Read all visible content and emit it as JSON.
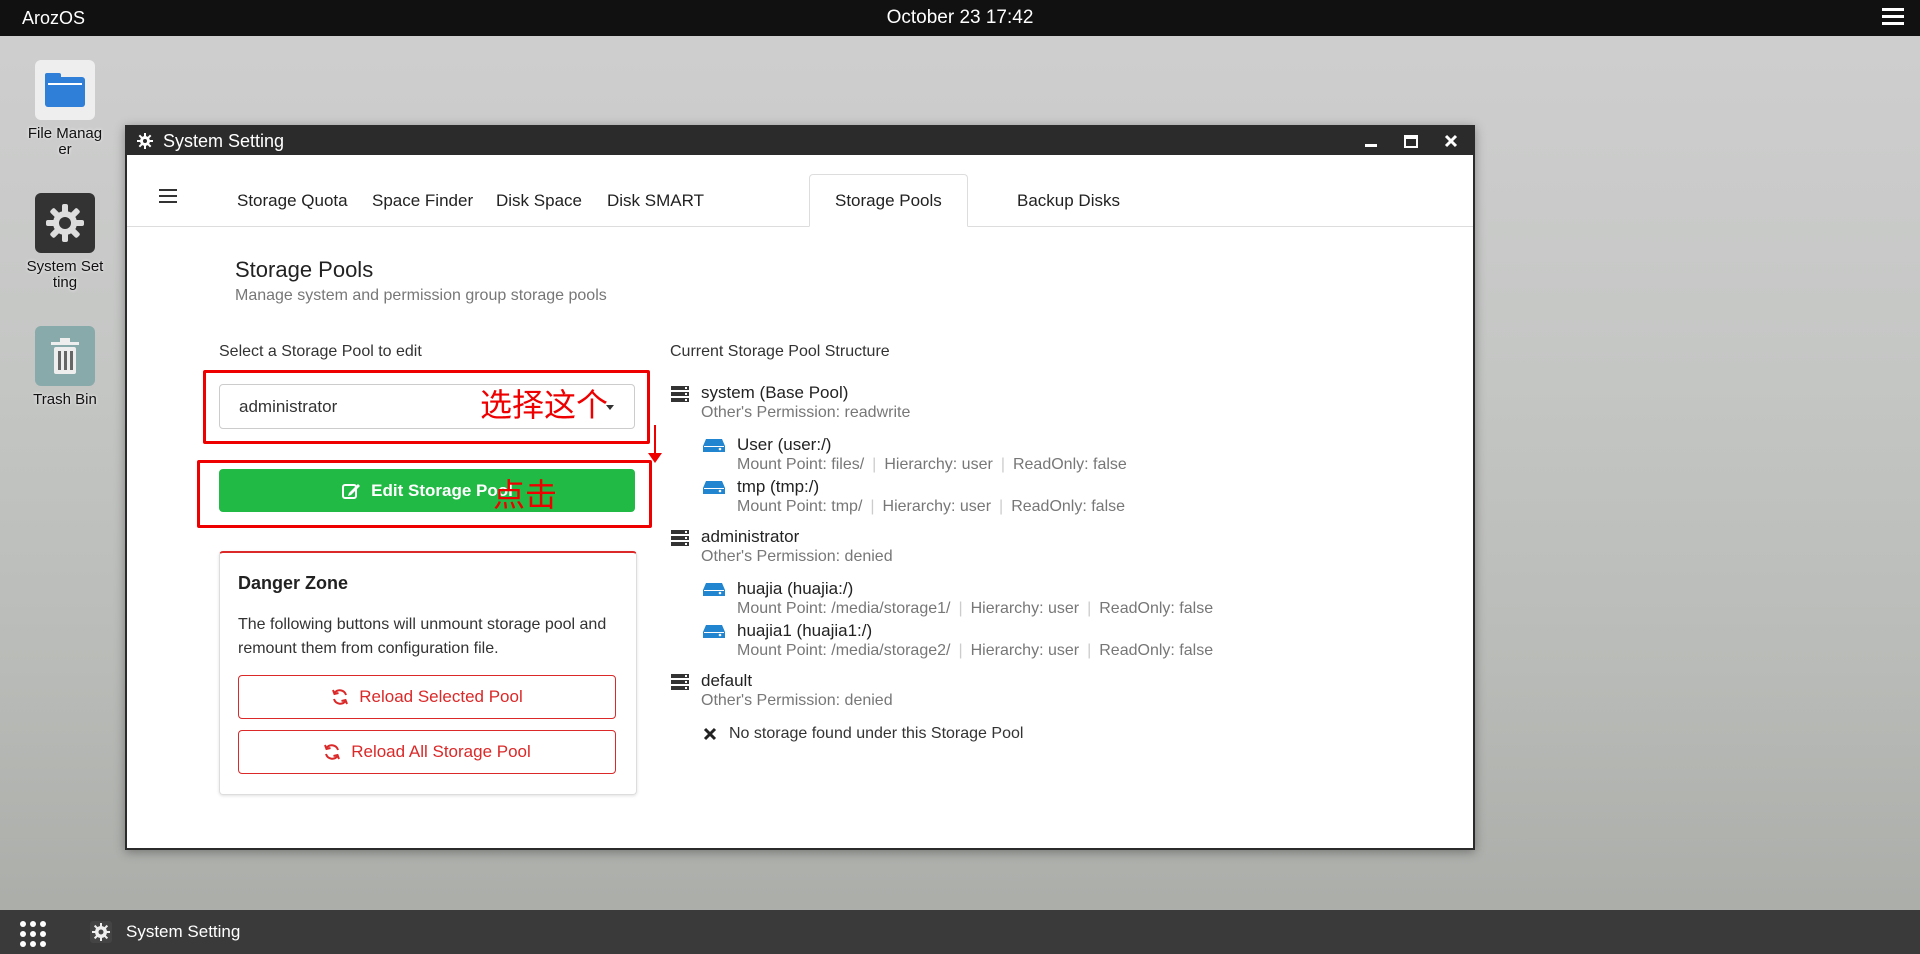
{
  "topbar": {
    "os_name": "ArozOS",
    "clock": "October 23 17:42"
  },
  "desktop": {
    "icons": [
      {
        "label": "File Manager"
      },
      {
        "label": "System Setting"
      },
      {
        "label": "Trash Bin"
      }
    ]
  },
  "window": {
    "title": "System Setting",
    "tabs": [
      {
        "label": "Storage Quota"
      },
      {
        "label": "Space Finder"
      },
      {
        "label": "Disk Space"
      },
      {
        "label": "Disk SMART"
      },
      {
        "label": "Storage Pools"
      },
      {
        "label": "Backup Disks"
      }
    ],
    "active_tab": "Storage Pools",
    "section": {
      "title": "Storage Pools",
      "subtitle": "Manage system and permission group storage pools"
    },
    "select": {
      "label": "Select a Storage Pool to edit",
      "value": "administrator"
    },
    "edit_button": "Edit Storage Pool",
    "danger_zone": {
      "title": "Danger Zone",
      "description": "The following buttons will unmount storage pool and remount them from configuration file.",
      "reload_selected": "Reload Selected Pool",
      "reload_all": "Reload All Storage Pool"
    },
    "structure": {
      "label": "Current Storage Pool Structure",
      "pools": [
        {
          "name": "system (Base Pool)",
          "permission": "Other's Permission: readwrite",
          "storages": [
            {
              "name": "User (user:/)",
              "mount": "Mount Point: files/",
              "hierarchy": "Hierarchy: user",
              "readonly": "ReadOnly: false"
            },
            {
              "name": "tmp (tmp:/)",
              "mount": "Mount Point: tmp/",
              "hierarchy": "Hierarchy: user",
              "readonly": "ReadOnly: false"
            }
          ]
        },
        {
          "name": "administrator",
          "permission": "Other's Permission: denied",
          "storages": [
            {
              "name": "huajia (huajia:/)",
              "mount": "Mount Point: /media/storage1/",
              "hierarchy": "Hierarchy: user",
              "readonly": "ReadOnly: false"
            },
            {
              "name": "huajia1 (huajia1:/)",
              "mount": "Mount Point: /media/storage2/",
              "hierarchy": "Hierarchy: user",
              "readonly": "ReadOnly: false"
            }
          ]
        },
        {
          "name": "default",
          "permission": "Other's Permission: denied",
          "empty_text": "No storage found under this Storage Pool"
        }
      ]
    }
  },
  "annotations": {
    "select_note": "选择这个",
    "click_note": "点击"
  },
  "taskbar": {
    "item_label": "System Setting"
  },
  "colors": {
    "accent_green": "#21ba45",
    "danger_red": "#db2828",
    "icon_blue": "#2185d0",
    "annotation_red": "#ee0000"
  }
}
